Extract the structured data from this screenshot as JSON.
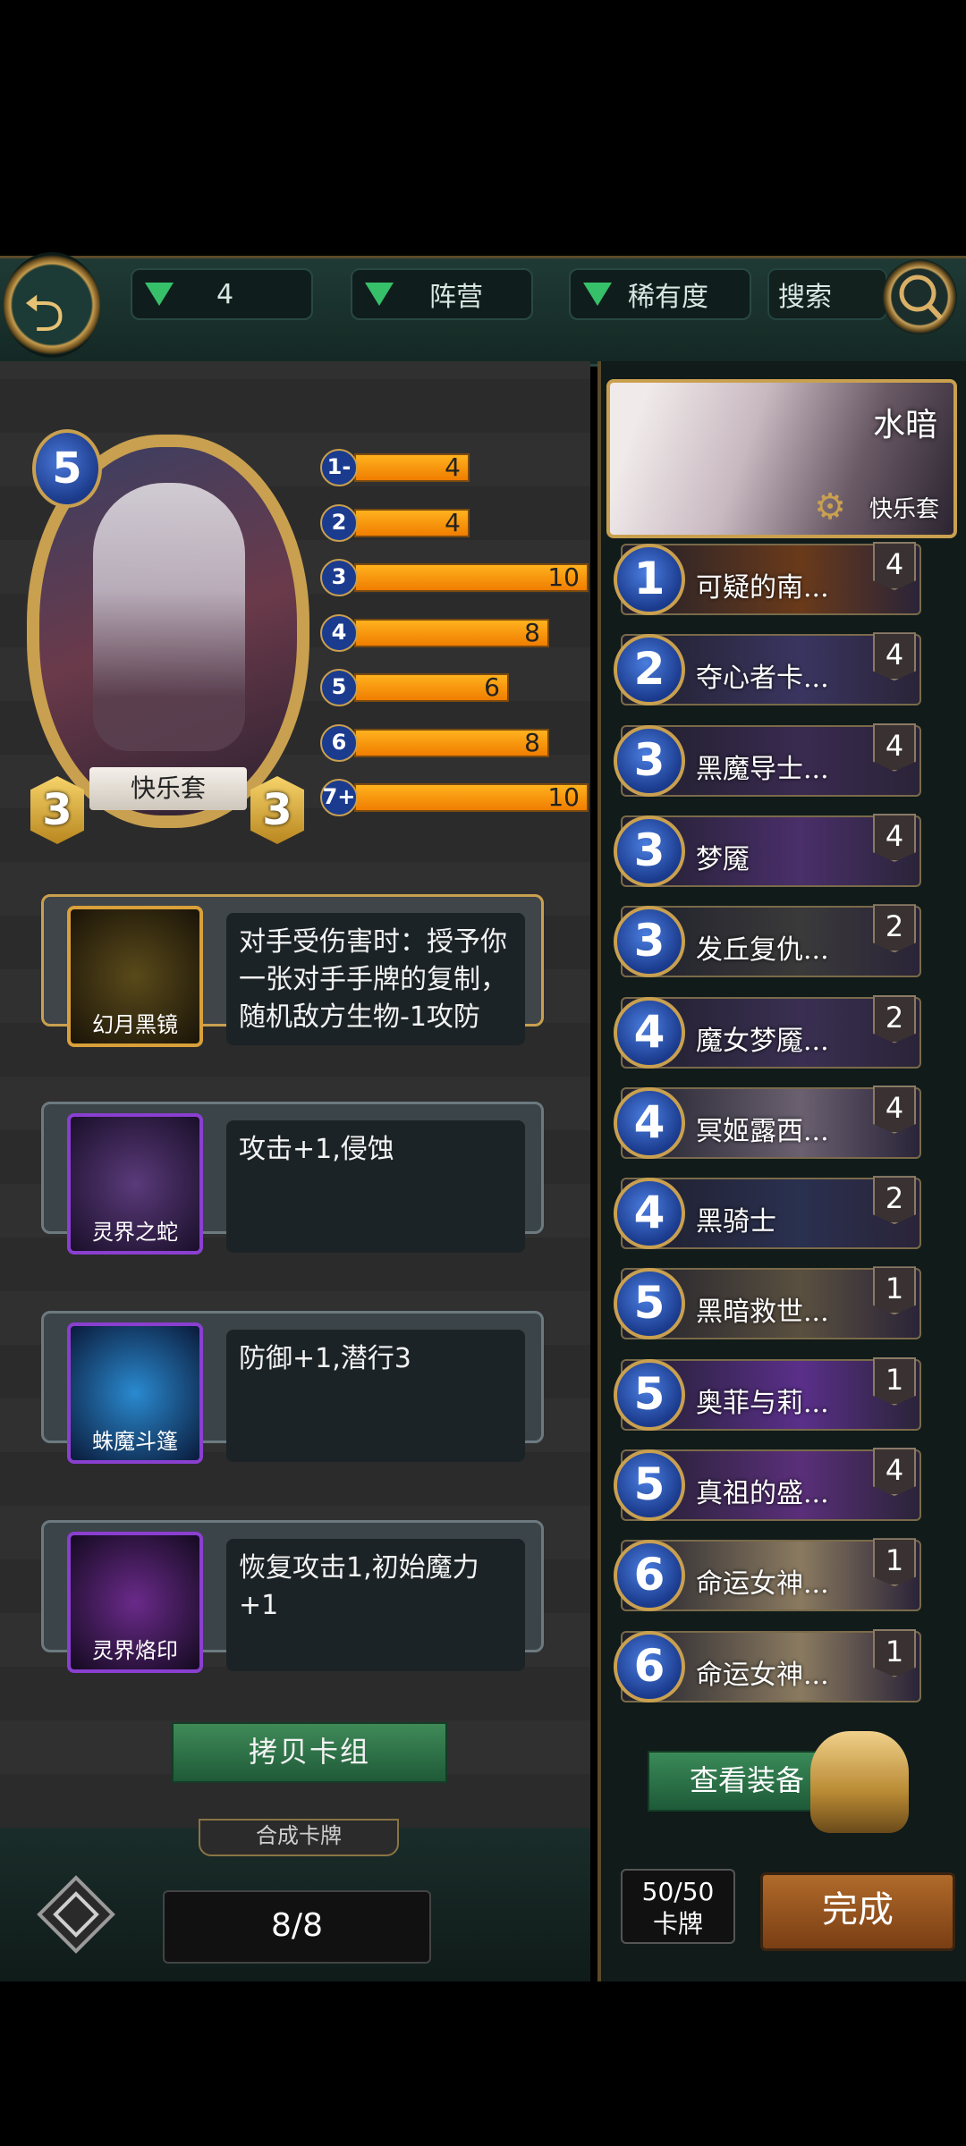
{
  "topbar": {
    "cost_filter": "4",
    "faction_filter": "阵营",
    "rarity_filter": "稀有度",
    "search_label": "搜索"
  },
  "hero": {
    "cost": "5",
    "attack": "3",
    "health": "3",
    "name": "快乐套"
  },
  "mana_curve": [
    {
      "cost": "1-",
      "count": "4",
      "fill": 0.4
    },
    {
      "cost": "2",
      "count": "4",
      "fill": 0.4
    },
    {
      "cost": "3",
      "count": "10",
      "fill": 1.0
    },
    {
      "cost": "4",
      "count": "8",
      "fill": 0.8
    },
    {
      "cost": "5",
      "count": "6",
      "fill": 0.6
    },
    {
      "cost": "6",
      "count": "8",
      "fill": 0.8
    },
    {
      "cost": "7+",
      "count": "10",
      "fill": 1.0
    }
  ],
  "equipment": [
    {
      "name": "幻月黑镜",
      "desc": "对手受伤害时：授予你一张对手手牌的复制，随机敌方生物-1攻防"
    },
    {
      "name": "灵界之蛇",
      "desc": "攻击+1,侵蚀"
    },
    {
      "name": "蛛魔斗篷",
      "desc": "防御+1,潜行3"
    },
    {
      "name": "灵界烙印",
      "desc": "恢复攻击1,初始魔力+1"
    }
  ],
  "copy_deck_label": "拷贝卡组",
  "synth_label": "合成卡牌",
  "synth_count": "8/8",
  "deck": {
    "faction": "水暗",
    "name": "快乐套"
  },
  "cards": [
    {
      "cost": "1",
      "name": "可疑的南...",
      "qty": "4"
    },
    {
      "cost": "2",
      "name": "夺心者卡...",
      "qty": "4"
    },
    {
      "cost": "3",
      "name": "黑魔导士...",
      "qty": "4"
    },
    {
      "cost": "3",
      "name": "梦魇",
      "qty": "4"
    },
    {
      "cost": "3",
      "name": "发丘复仇...",
      "qty": "2"
    },
    {
      "cost": "4",
      "name": "魔女梦魇...",
      "qty": "2"
    },
    {
      "cost": "4",
      "name": "冥姬露西...",
      "qty": "4"
    },
    {
      "cost": "4",
      "name": "黑骑士",
      "qty": "2"
    },
    {
      "cost": "5",
      "name": "黑暗救世...",
      "qty": "1"
    },
    {
      "cost": "5",
      "name": "奥菲与莉...",
      "qty": "1"
    },
    {
      "cost": "5",
      "name": "真祖的盛...",
      "qty": "4"
    },
    {
      "cost": "6",
      "name": "命运女神...",
      "qty": "1"
    },
    {
      "cost": "6",
      "name": "命运女神...",
      "qty": "1"
    }
  ],
  "view_equipment_label": "查看装备",
  "card_total": "50/50",
  "card_total_label": "卡牌",
  "done_label": "完成"
}
